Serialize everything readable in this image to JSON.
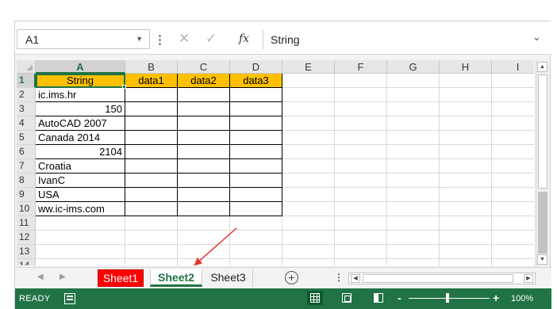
{
  "formula_bar": {
    "name_box": "A1",
    "formula": "String",
    "cancel_icon": "close-icon",
    "enter_icon": "check-icon",
    "function_icon": "fx-icon"
  },
  "columns": [
    "A",
    "B",
    "C",
    "D",
    "E",
    "F",
    "G",
    "H",
    "I"
  ],
  "rows": [
    "1",
    "2",
    "3",
    "4",
    "5",
    "6",
    "7",
    "8",
    "9",
    "10",
    "11",
    "12",
    "13",
    "14"
  ],
  "cells": {
    "headers": [
      "String",
      "data1",
      "data2",
      "data3"
    ],
    "col_a": [
      "ic.ims.hr",
      "150",
      "AutoCAD 2007",
      "Canada 2014",
      "2104",
      "Croatia",
      "IvanC",
      "USA",
      "ww.ic-ims.com"
    ]
  },
  "sheet_tabs": {
    "tabs": [
      "Sheet1",
      "Sheet2",
      "Sheet3"
    ],
    "active": "Sheet2",
    "colored_tab_color": "#ff0000",
    "add_icon": "plus-circle-icon"
  },
  "status_bar": {
    "status": "READY",
    "zoom_minus": "-",
    "zoom_plus": "+",
    "zoom": "100%",
    "zoom_fraction": 0.5
  },
  "colors": {
    "accent": "#217346",
    "header_fill": "#ffc000",
    "annotation_arrow": "#e8322c"
  }
}
